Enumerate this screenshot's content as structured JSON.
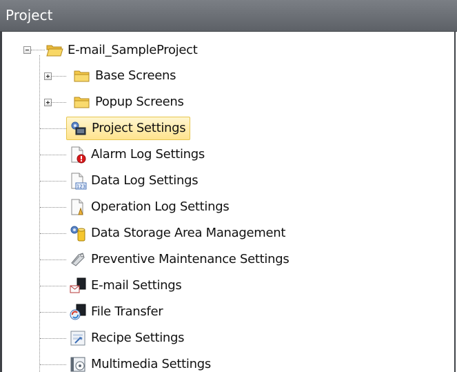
{
  "panel": {
    "title": "Project"
  },
  "tree": {
    "root": {
      "label": "E-mail_SampleProject",
      "icon": "folder-open-icon",
      "expanded": true
    },
    "items": [
      {
        "label": "Base Screens",
        "icon": "folder-icon",
        "expandable": true
      },
      {
        "label": "Popup Screens",
        "icon": "folder-icon",
        "expandable": true
      },
      {
        "label": "Project Settings",
        "icon": "project-settings-icon",
        "selected": true
      },
      {
        "label": "Alarm Log Settings",
        "icon": "alarm-log-icon"
      },
      {
        "label": "Data Log Settings",
        "icon": "data-log-icon"
      },
      {
        "label": "Operation Log Settings",
        "icon": "operation-log-icon"
      },
      {
        "label": "Data Storage Area Management",
        "icon": "data-storage-icon"
      },
      {
        "label": "Preventive Maintenance Settings",
        "icon": "preventive-maintenance-icon"
      },
      {
        "label": "E-mail Settings",
        "icon": "email-settings-icon"
      },
      {
        "label": "File Transfer",
        "icon": "file-transfer-icon"
      },
      {
        "label": "Recipe Settings",
        "icon": "recipe-icon"
      },
      {
        "label": "Multimedia Settings",
        "icon": "multimedia-icon"
      }
    ]
  },
  "colors": {
    "titlebar": "#676b71",
    "selection": "#ffe38e",
    "folder": "#f7cf52"
  }
}
